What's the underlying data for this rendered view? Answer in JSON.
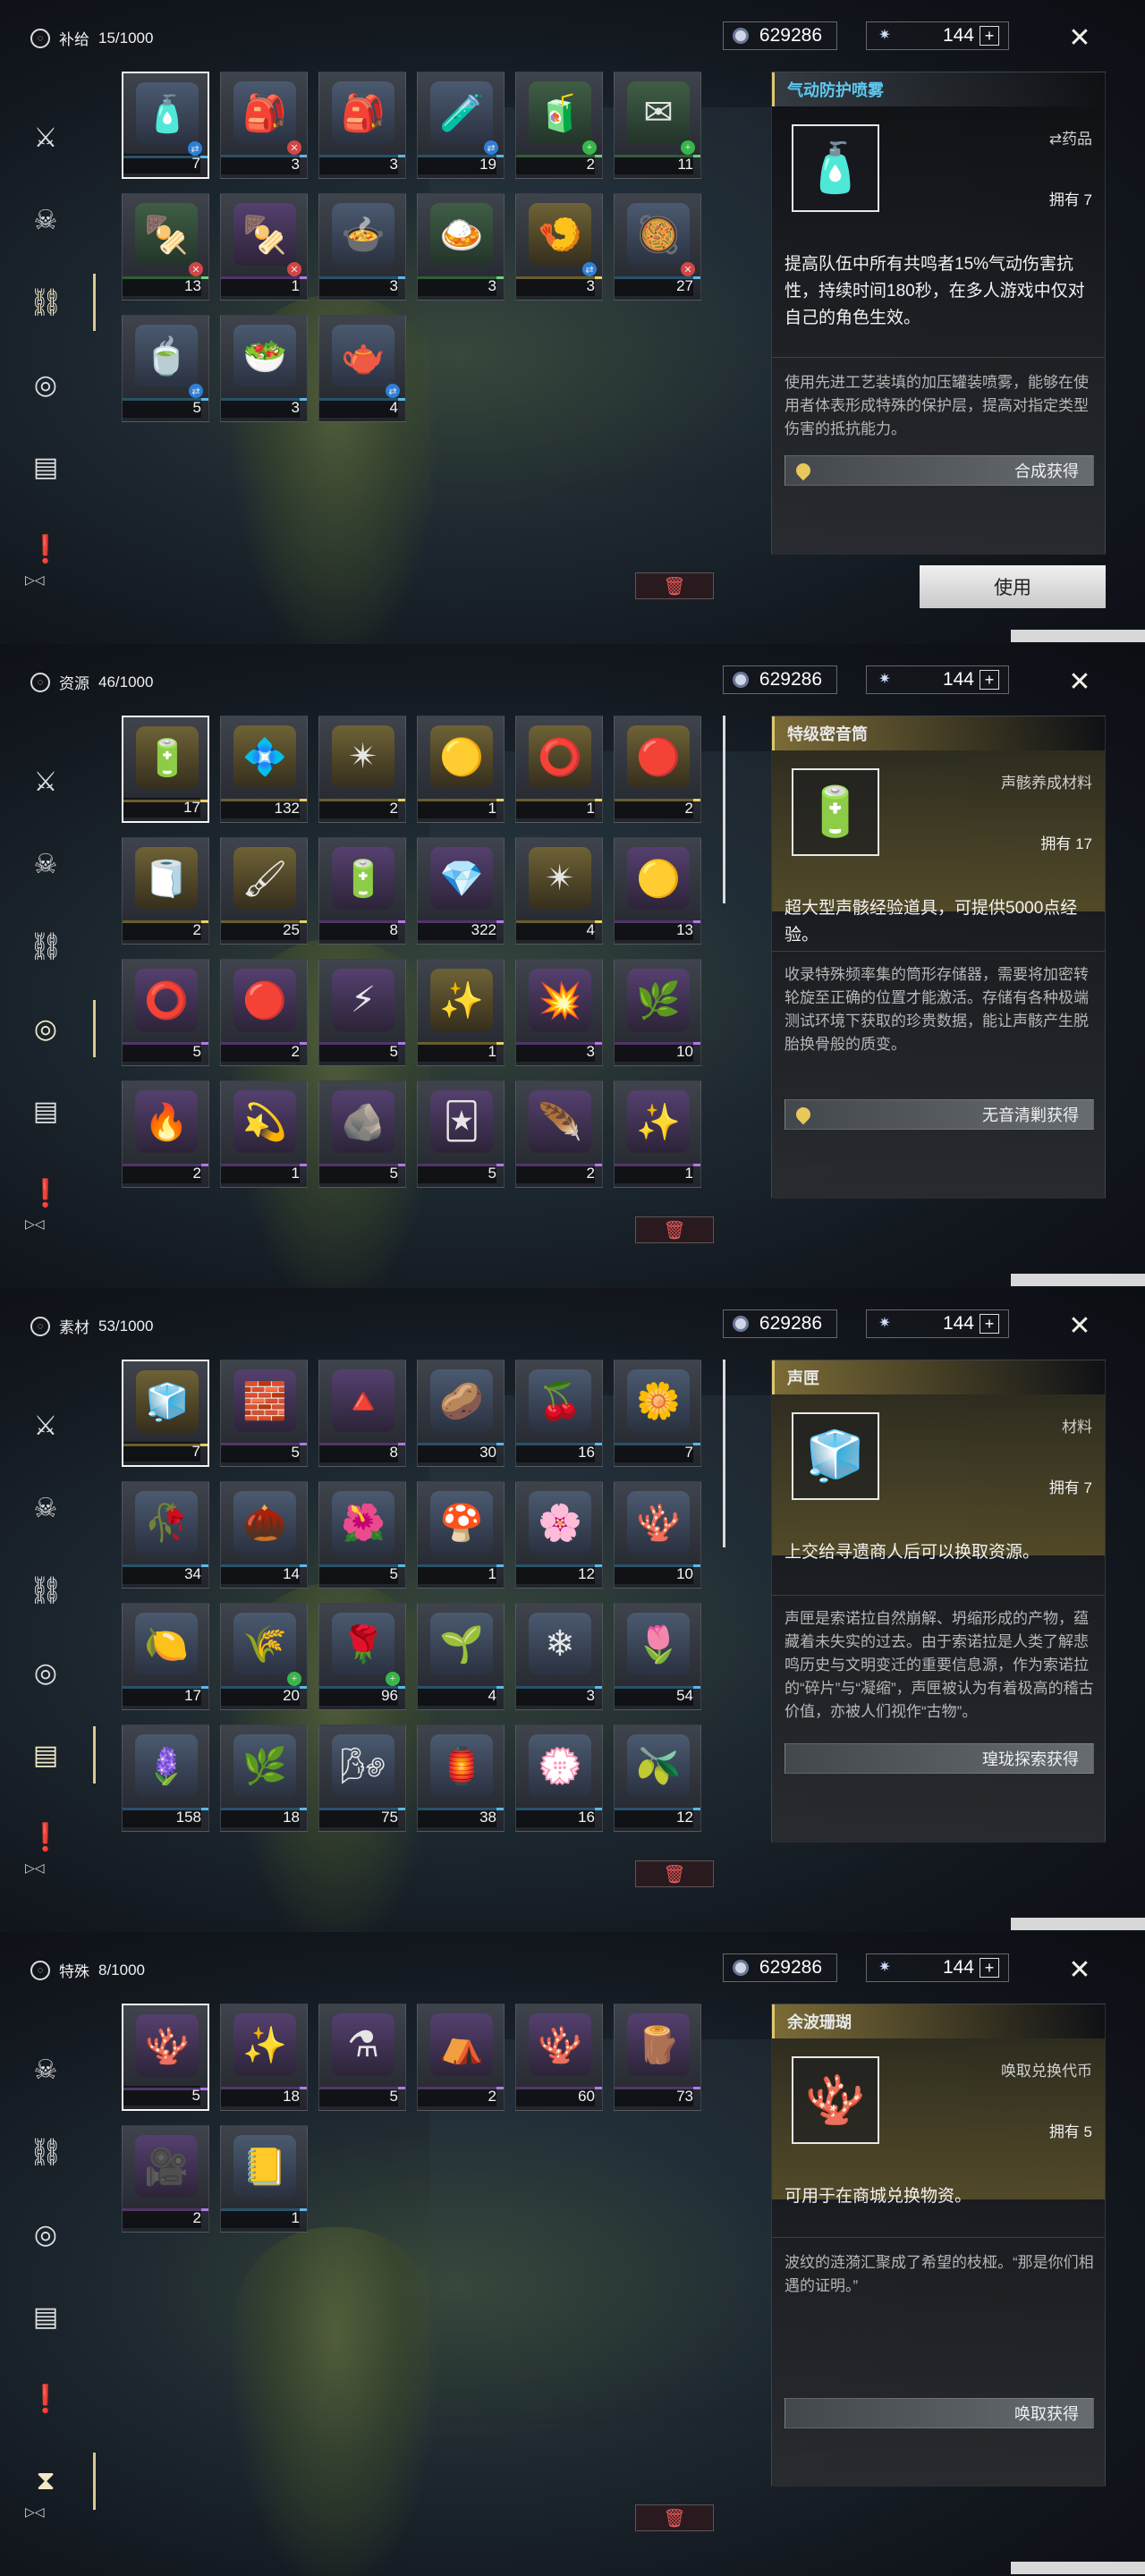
{
  "currencies": {
    "shell_credit": "629286",
    "astrite": "144",
    "plus": "+"
  },
  "sidebar_bottom": "▷◁",
  "panels": [
    {
      "category": "补给",
      "count": "15/1000",
      "sidebar": [
        "⚔",
        "☠",
        "⛓",
        "◎",
        "▤",
        "❗"
      ],
      "active": 2,
      "items": [
        {
          "count": "7",
          "sel": true,
          "q": "blue",
          "icon": "🧴",
          "badge": "⇄",
          "bcolor": "#2e7fd6"
        },
        {
          "count": "3",
          "q": "blue",
          "icon": "🎒",
          "badge": "✕",
          "bcolor": "#d24646"
        },
        {
          "count": "3",
          "q": "blue",
          "icon": "🎒",
          "badge": "",
          "bcolor": ""
        },
        {
          "count": "19",
          "q": "blue",
          "icon": "🧪",
          "badge": "⇄",
          "bcolor": "#2e7fd6"
        },
        {
          "count": "2",
          "q": "green",
          "icon": "🧃",
          "badge": "+",
          "bcolor": "#37b64a"
        },
        {
          "count": "11",
          "q": "green",
          "icon": "✉",
          "badge": "+",
          "bcolor": "#37b64a"
        },
        {
          "count": "13",
          "q": "green",
          "icon": "🍢",
          "badge": "✕",
          "bcolor": "#d24646"
        },
        {
          "count": "1",
          "q": "purple",
          "icon": "🍢",
          "badge": "✕",
          "bcolor": "#d24646"
        },
        {
          "count": "3",
          "q": "blue",
          "icon": "🍲",
          "badge": "",
          "bcolor": ""
        },
        {
          "count": "3",
          "q": "green",
          "icon": "🍛",
          "badge": "",
          "bcolor": ""
        },
        {
          "count": "3",
          "q": "gold",
          "icon": "🍤",
          "badge": "⇄",
          "bcolor": "#2e7fd6"
        },
        {
          "count": "27",
          "q": "blue",
          "icon": "🥘",
          "badge": "✕",
          "bcolor": "#d24646"
        },
        {
          "count": "5",
          "q": "blue",
          "icon": "🍵",
          "badge": "⇄",
          "bcolor": "#2e7fd6"
        },
        {
          "count": "3",
          "q": "blue",
          "icon": "🥗",
          "badge": "",
          "bcolor": ""
        },
        {
          "count": "4",
          "q": "blue",
          "icon": "🫖",
          "badge": "⇄",
          "bcolor": "#2e7fd6"
        }
      ],
      "detail": {
        "title": "气动防护喷雾",
        "type": "⇄药品",
        "owned": "拥有 7",
        "icon": "🧴",
        "desc": "提高队伍中所有共鸣者15%气动伤害抗性，持续时间180秒，在多人游戏中仅对自己的角色生效。",
        "lore": "使用先进工艺装填的加压罐装喷雾，能够在使用者体表形成特殊的保护层，提高对指定类型伤害的抵抗能力。",
        "obtain": "合成获得",
        "use": "使用"
      }
    },
    {
      "category": "资源",
      "count": "46/1000",
      "sidebar": [
        "⚔",
        "☠",
        "⛓",
        "◎",
        "▤",
        "❗"
      ],
      "active": 3,
      "items": [
        {
          "count": "17",
          "sel": true,
          "q": "gold",
          "icon": "🔋"
        },
        {
          "count": "132",
          "q": "gold",
          "icon": "💠"
        },
        {
          "count": "2",
          "q": "gold",
          "icon": "✴"
        },
        {
          "count": "1",
          "q": "gold",
          "icon": "🟡"
        },
        {
          "count": "1",
          "q": "gold",
          "icon": "⭕"
        },
        {
          "count": "2",
          "q": "gold",
          "icon": "🔴"
        },
        {
          "count": "2",
          "q": "gold",
          "icon": "🧻"
        },
        {
          "count": "25",
          "q": "gold",
          "icon": "🖌"
        },
        {
          "count": "8",
          "q": "purple",
          "icon": "🔋"
        },
        {
          "count": "322",
          "q": "purple",
          "icon": "💎"
        },
        {
          "count": "4",
          "q": "gold",
          "icon": "✴"
        },
        {
          "count": "13",
          "q": "purple",
          "icon": "🟡"
        },
        {
          "count": "5",
          "q": "purple",
          "icon": "⭕"
        },
        {
          "count": "2",
          "q": "purple",
          "icon": "🔴"
        },
        {
          "count": "5",
          "q": "purple",
          "icon": "⚡"
        },
        {
          "count": "1",
          "q": "gold",
          "icon": "✨"
        },
        {
          "count": "3",
          "q": "purple",
          "icon": "💥"
        },
        {
          "count": "10",
          "q": "purple",
          "icon": "🌿"
        },
        {
          "count": "2",
          "q": "purple",
          "icon": "🔥"
        },
        {
          "count": "1",
          "q": "purple",
          "icon": "💫"
        },
        {
          "count": "5",
          "q": "purple",
          "icon": "🪨"
        },
        {
          "count": "5",
          "q": "purple",
          "icon": "🃏"
        },
        {
          "count": "2",
          "q": "purple",
          "icon": "🪶"
        },
        {
          "count": "1",
          "q": "purple",
          "icon": "✨"
        }
      ],
      "detail": {
        "title": "特级密音筒",
        "type": "声骸养成材料",
        "owned": "拥有 17",
        "icon": "🔋",
        "desc": "超大型声骸经验道具，可提供5000点经验。",
        "lore": "收录特殊频率集的筒形存储器，需要将加密转轮旋至正确的位置才能激活。存储有各种极端测试环境下获取的珍贵数据，能让声骸产生脱胎换骨般的质变。",
        "obtain": "无音清剿获得",
        "use": ""
      }
    },
    {
      "category": "素材",
      "count": "53/1000",
      "sidebar": [
        "⚔",
        "☠",
        "⛓",
        "◎",
        "▤",
        "❗"
      ],
      "active": 4,
      "items": [
        {
          "count": "7",
          "sel": true,
          "q": "gold",
          "icon": "🧊"
        },
        {
          "count": "5",
          "q": "purple",
          "icon": "🧱"
        },
        {
          "count": "8",
          "q": "purple",
          "icon": "🔺"
        },
        {
          "count": "30",
          "q": "blue",
          "icon": "🥔"
        },
        {
          "count": "16",
          "q": "blue",
          "icon": "🍒"
        },
        {
          "count": "7",
          "q": "blue",
          "icon": "🌼"
        },
        {
          "count": "34",
          "q": "blue",
          "icon": "🥀"
        },
        {
          "count": "14",
          "q": "blue",
          "icon": "🌰"
        },
        {
          "count": "5",
          "q": "blue",
          "icon": "🌺"
        },
        {
          "count": "1",
          "q": "blue",
          "icon": "🍄"
        },
        {
          "count": "12",
          "q": "blue",
          "icon": "🌸"
        },
        {
          "count": "10",
          "q": "blue",
          "icon": "🪸"
        },
        {
          "count": "17",
          "q": "blue",
          "icon": "🍋"
        },
        {
          "count": "20",
          "q": "blue",
          "icon": "🌾",
          "badge": "+",
          "bcolor": "#37b64a"
        },
        {
          "count": "96",
          "q": "blue",
          "icon": "🌹",
          "badge": "+",
          "bcolor": "#37b64a"
        },
        {
          "count": "4",
          "q": "blue",
          "icon": "🌱"
        },
        {
          "count": "3",
          "q": "blue",
          "icon": "❄"
        },
        {
          "count": "54",
          "q": "blue",
          "icon": "🌷"
        },
        {
          "count": "158",
          "q": "blue",
          "icon": "🪻"
        },
        {
          "count": "18",
          "q": "blue",
          "icon": "🌿"
        },
        {
          "count": "75",
          "q": "blue",
          "icon": "🌬"
        },
        {
          "count": "38",
          "q": "blue",
          "icon": "🏮"
        },
        {
          "count": "16",
          "q": "blue",
          "icon": "💮"
        },
        {
          "count": "12",
          "q": "blue",
          "icon": "🫒"
        }
      ],
      "detail": {
        "title": "声匣",
        "type": "材料",
        "owned": "拥有 7",
        "icon": "🧊",
        "desc": "上交给寻遗商人后可以换取资源。",
        "lore": "声匣是索诺拉自然崩解、坍缩形成的产物，蕴藏着未失实的过去。由于索诺拉是人类了解悲鸣历史与文明变迁的重要信息源，作为索诺拉的“碎片”与“凝缩”，声匣被认为有着极高的稽古价值，亦被人们视作“古物”。",
        "obtain": "瑝珑探索获得",
        "use": ""
      }
    },
    {
      "category": "特殊",
      "count": "8/1000",
      "sidebar": [
        "☠",
        "⛓",
        "◎",
        "▤",
        "❗",
        "⧗"
      ],
      "active": 5,
      "items": [
        {
          "count": "5",
          "sel": true,
          "q": "purple",
          "icon": "🪸"
        },
        {
          "count": "18",
          "q": "purple",
          "icon": "✨"
        },
        {
          "count": "5",
          "q": "purple",
          "icon": "⚗"
        },
        {
          "count": "2",
          "q": "purple",
          "icon": "⛺"
        },
        {
          "count": "60",
          "q": "purple",
          "icon": "🪸"
        },
        {
          "count": "73",
          "q": "purple",
          "icon": "🪵"
        },
        {
          "count": "2",
          "q": "purple",
          "icon": "🎥"
        },
        {
          "count": "1",
          "q": "blue",
          "icon": "📒"
        }
      ],
      "detail": {
        "title": "余波珊瑚",
        "type": "唤取兑换代币",
        "owned": "拥有 5",
        "icon": "🪸",
        "desc": "可用于在商城兑换物资。",
        "lore": "波纹的涟漪汇聚成了希望的枝桠。“那是你们相遇的证明。”",
        "obtain": "唤取获得",
        "use": ""
      }
    }
  ]
}
